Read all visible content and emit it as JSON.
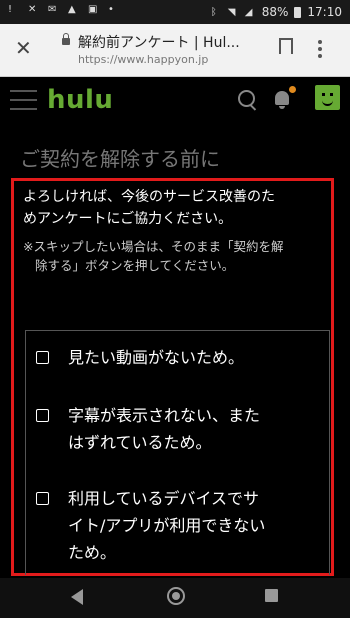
{
  "status_bar": {
    "notifications": [
      "!",
      "✕",
      "✉",
      "▲",
      "▣",
      "•"
    ],
    "battery": "88%",
    "time": "17:10"
  },
  "browser": {
    "page_title": "解約前アンケート | Hul...",
    "url": "https://www.happyon.jp"
  },
  "header": {
    "logo": "hulu",
    "accent_color": "#66aa33",
    "notification_dot_color": "#e08a1e"
  },
  "page": {
    "title": "ご契約を解除する前に",
    "intro_line1": "よろしければ、今後のサービス改善のた",
    "intro_line2": "めアンケートにご協力ください。",
    "note_line1": "※スキップしたい場合は、そのまま「契約を解",
    "note_line2": "除する」ボタンを押してください。"
  },
  "survey": {
    "options": [
      {
        "lines": [
          "見たい動画がないため。"
        ],
        "checked": false
      },
      {
        "lines": [
          "字幕が表示されない、また",
          "はずれているため。"
        ],
        "checked": false
      },
      {
        "lines": [
          "利用しているデバイスでサ",
          "イト/アプリが利用できない",
          "ため。"
        ],
        "checked": false
      }
    ]
  },
  "highlight_color": "#e21b1b"
}
